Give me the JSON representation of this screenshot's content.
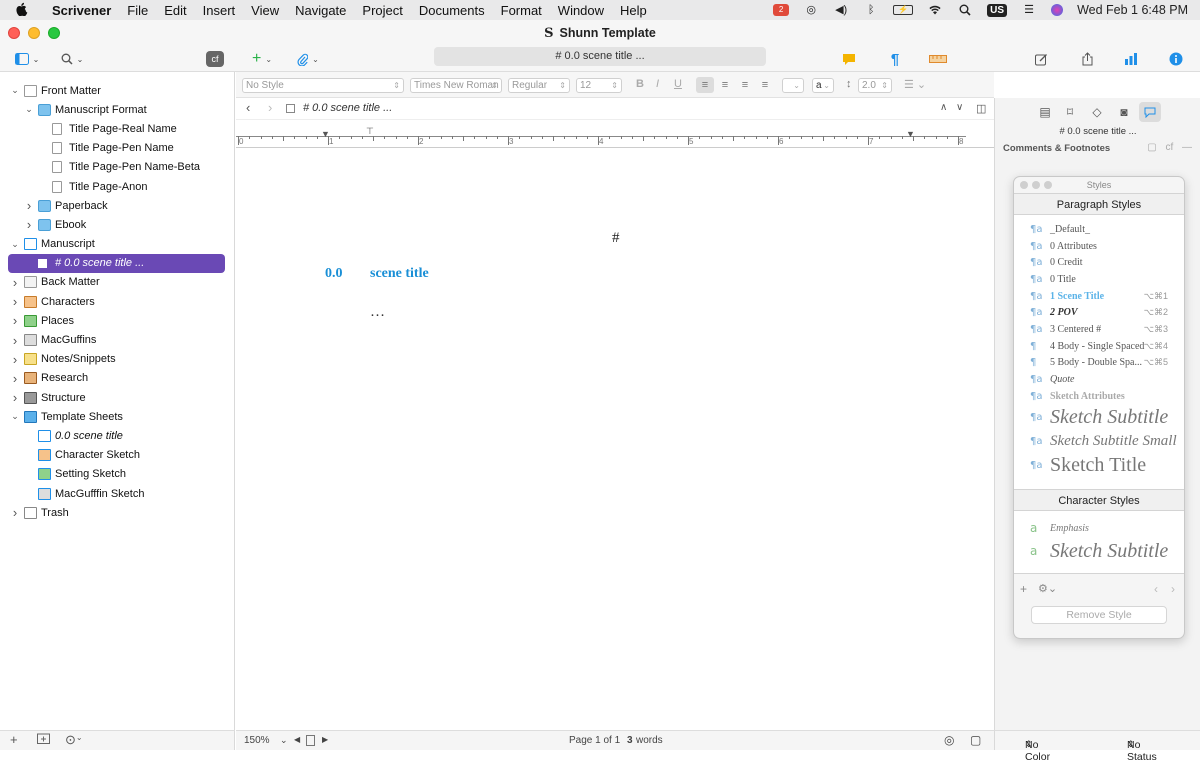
{
  "menubar": {
    "apple": "",
    "items": [
      "Scrivener",
      "File",
      "Edit",
      "Insert",
      "View",
      "Navigate",
      "Project",
      "Documents",
      "Format",
      "Window",
      "Help"
    ],
    "status_icons": [
      "dropbox-icon",
      "airdrop-icon",
      "volume-icon",
      "bluetooth-icon",
      "battery-icon",
      "wifi-icon",
      "spotlight-icon"
    ],
    "input_source": "US",
    "datetime": "Wed Feb 1  6:48 PM"
  },
  "window": {
    "title": "Shunn Template"
  },
  "toolbar": {
    "compile_label": "cf",
    "path": "# 0.0 scene title ..."
  },
  "binder": {
    "items": [
      {
        "label": "Front Matter",
        "indent": 0,
        "chevron": "down",
        "icon": "front-matter-icon"
      },
      {
        "label": "Manuscript Format",
        "indent": 1,
        "chevron": "down",
        "icon": "folder-icon"
      },
      {
        "label": "Title Page-Real Name",
        "indent": 2,
        "chevron": "",
        "icon": "document-icon"
      },
      {
        "label": "Title Page-Pen Name",
        "indent": 2,
        "chevron": "",
        "icon": "document-icon"
      },
      {
        "label": "Title Page-Pen Name-Beta",
        "indent": 2,
        "chevron": "",
        "icon": "document-icon"
      },
      {
        "label": "Title Page-Anon",
        "indent": 2,
        "chevron": "",
        "icon": "document-icon"
      },
      {
        "label": "Paperback",
        "indent": 1,
        "chevron": "right",
        "icon": "folder-icon"
      },
      {
        "label": "Ebook",
        "indent": 1,
        "chevron": "right",
        "icon": "folder-icon"
      },
      {
        "label": "Manuscript",
        "indent": 0,
        "chevron": "down",
        "icon": "manuscript-icon"
      },
      {
        "label": "# 0.0 scene title ...",
        "indent": 1,
        "chevron": "",
        "icon": "document-icon",
        "selected": true
      },
      {
        "label": "Back Matter",
        "indent": 0,
        "chevron": "right",
        "icon": "back-matter-icon"
      },
      {
        "label": "Characters",
        "indent": 0,
        "chevron": "right",
        "icon": "characters-icon"
      },
      {
        "label": "Places",
        "indent": 0,
        "chevron": "right",
        "icon": "places-icon"
      },
      {
        "label": "MacGuffins",
        "indent": 0,
        "chevron": "right",
        "icon": "macguffins-icon"
      },
      {
        "label": "Notes/Snippets",
        "indent": 0,
        "chevron": "right",
        "icon": "notes-icon"
      },
      {
        "label": "Research",
        "indent": 0,
        "chevron": "right",
        "icon": "research-icon"
      },
      {
        "label": "Structure",
        "indent": 0,
        "chevron": "right",
        "icon": "structure-icon"
      },
      {
        "label": "Template Sheets",
        "indent": 0,
        "chevron": "down",
        "icon": "template-sheets-icon"
      },
      {
        "label": "0.0 scene title",
        "indent": 1,
        "chevron": "",
        "icon": "scene-template-icon",
        "italic": true
      },
      {
        "label": "Character Sketch",
        "indent": 1,
        "chevron": "",
        "icon": "character-sketch-icon"
      },
      {
        "label": "Setting Sketch",
        "indent": 1,
        "chevron": "",
        "icon": "setting-sketch-icon"
      },
      {
        "label": "MacGufffin Sketch",
        "indent": 1,
        "chevron": "",
        "icon": "macguffin-sketch-icon"
      },
      {
        "label": "Trash",
        "indent": 0,
        "chevron": "right",
        "icon": "trash-icon"
      }
    ]
  },
  "formatbar": {
    "style": "No Style",
    "font": "Times New Roman",
    "weight": "Regular",
    "size": "12",
    "line_spacing": "2.0",
    "text_color_label": "a"
  },
  "header": {
    "doc_title": "# 0.0 scene title ..."
  },
  "ruler": {
    "numbers": [
      "0",
      "1",
      "2",
      "3",
      "4",
      "5",
      "6",
      "7",
      "8"
    ]
  },
  "editor": {
    "hash": "#",
    "scene_number": "0.0",
    "scene_title": "scene title",
    "ellipsis": "…"
  },
  "editor_footer": {
    "zoom": "150%",
    "page_info": "Page 1 of 1",
    "word_count_num": "3",
    "word_count_label": "words"
  },
  "inspector": {
    "doc_title": "# 0.0 scene title ...",
    "section": "Comments & Footnotes",
    "cf_label": "cf"
  },
  "styles_panel": {
    "title": "Styles",
    "paragraph_header": "Paragraph Styles",
    "paragraph_styles": [
      {
        "name": "_Default_",
        "shortcut": "",
        "glyph": "¶a",
        "size": 10,
        "color": "#555",
        "bold": false,
        "italic": false
      },
      {
        "name": "0 Attributes",
        "shortcut": "",
        "glyph": "¶a",
        "size": 10,
        "color": "#555",
        "bold": false,
        "italic": false
      },
      {
        "name": "0 Credit",
        "shortcut": "",
        "glyph": "¶a",
        "size": 10,
        "color": "#555",
        "bold": false,
        "italic": false
      },
      {
        "name": "0 Title",
        "shortcut": "",
        "glyph": "¶a",
        "size": 10,
        "color": "#555",
        "bold": false,
        "italic": false
      },
      {
        "name": "1 Scene Title",
        "shortcut": "⌥⌘1",
        "glyph": "¶a",
        "size": 10,
        "color": "#5bb3e8",
        "bold": true,
        "italic": false
      },
      {
        "name": "2 POV",
        "shortcut": "⌥⌘2",
        "glyph": "¶a",
        "size": 10,
        "color": "#333",
        "bold": true,
        "italic": true
      },
      {
        "name": "3 Centered #",
        "shortcut": "⌥⌘3",
        "glyph": "¶a",
        "size": 10,
        "color": "#555",
        "bold": false,
        "italic": false
      },
      {
        "name": "4 Body - Single Spaced",
        "shortcut": "⌥⌘4",
        "glyph": "¶",
        "size": 10,
        "color": "#555",
        "bold": false,
        "italic": false
      },
      {
        "name": "5 Body - Double Spa...",
        "shortcut": "⌥⌘5",
        "glyph": "¶",
        "size": 10,
        "color": "#555",
        "bold": false,
        "italic": false
      },
      {
        "name": "Quote",
        "shortcut": "",
        "glyph": "¶a",
        "size": 10,
        "color": "#555",
        "bold": false,
        "italic": true
      },
      {
        "name": "Sketch Attributes",
        "shortcut": "",
        "glyph": "¶a",
        "size": 10,
        "color": "#aaa",
        "bold": true,
        "italic": false
      },
      {
        "name": "Sketch Subtitle",
        "shortcut": "",
        "glyph": "¶a",
        "size": 20,
        "color": "#777",
        "bold": false,
        "italic": true
      },
      {
        "name": "Sketch Subtitle Small",
        "shortcut": "",
        "glyph": "¶a",
        "size": 15,
        "color": "#777",
        "bold": false,
        "italic": true
      },
      {
        "name": "Sketch Title",
        "shortcut": "",
        "glyph": "¶a",
        "size": 20,
        "color": "#777",
        "bold": false,
        "italic": false
      }
    ],
    "character_header": "Character Styles",
    "character_styles": [
      {
        "name": "Emphasis",
        "glyph": "a",
        "size": 10,
        "color": "#777",
        "italic": true
      },
      {
        "name": "Sketch Subtitle",
        "glyph": "a",
        "size": 20,
        "color": "#777",
        "italic": true
      }
    ],
    "remove_label": "Remove Style"
  },
  "inspector_footer": {
    "color_label": "No Color",
    "status_label": "No Status"
  },
  "colors": {
    "selection": "#6a49b5",
    "scene_blue": "#1a8fd6",
    "accent_blue": "#1f8fe8"
  }
}
